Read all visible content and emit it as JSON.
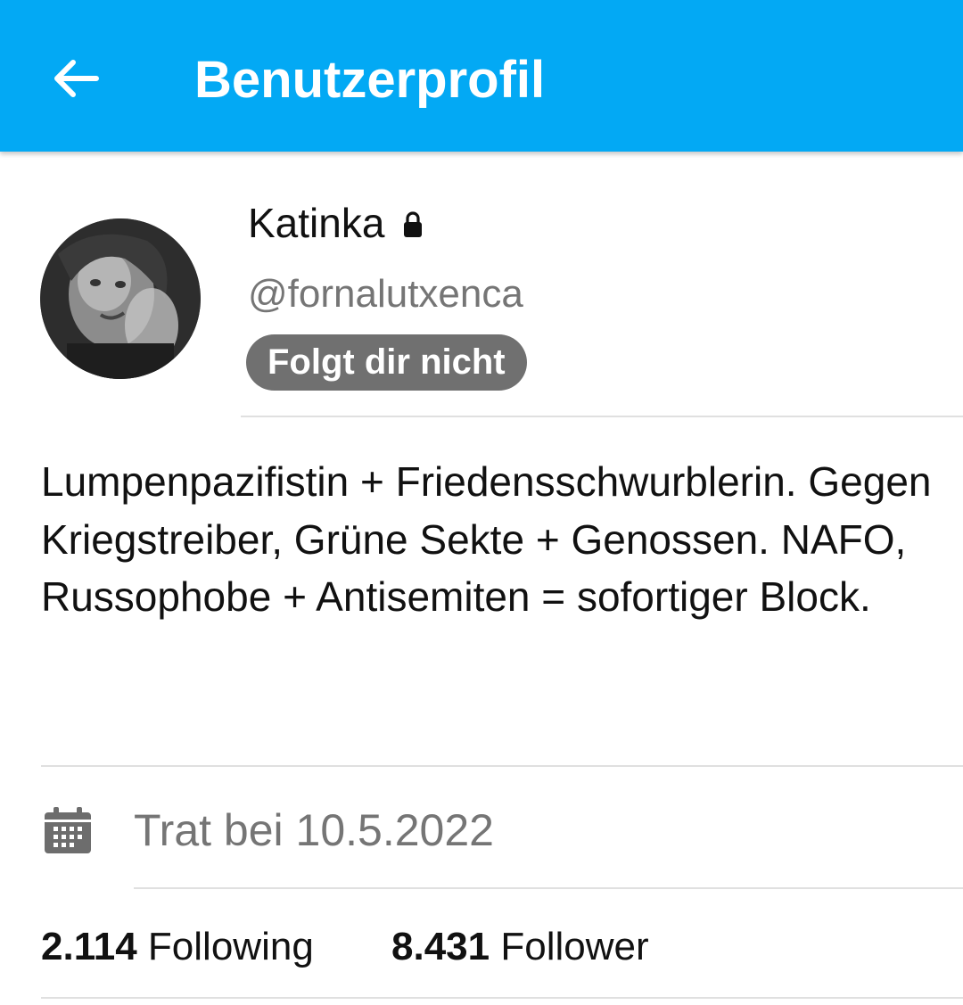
{
  "app_bar": {
    "back_icon": "arrow-left-icon",
    "title": "Benutzerprofil",
    "background_color": "#03a9f4"
  },
  "profile": {
    "display_name": "Katinka",
    "locked_icon": "lock-icon",
    "handle": "@fornalutxenca",
    "follow_status": "Folgt dir nicht",
    "bio": "Lumpenpazifistin + Friedensschwurblerin. Gegen Kriegstreiber, Grüne Sekte + Genossen. NAFO, Russophobe + Antisemiten = sofortiger Block.",
    "joined": {
      "icon": "calendar-icon",
      "text": "Trat bei 10.5.2022"
    },
    "stats": {
      "following_count": "2.114",
      "following_label": "Following",
      "follower_count": "8.431",
      "follower_label": "Follower"
    }
  }
}
